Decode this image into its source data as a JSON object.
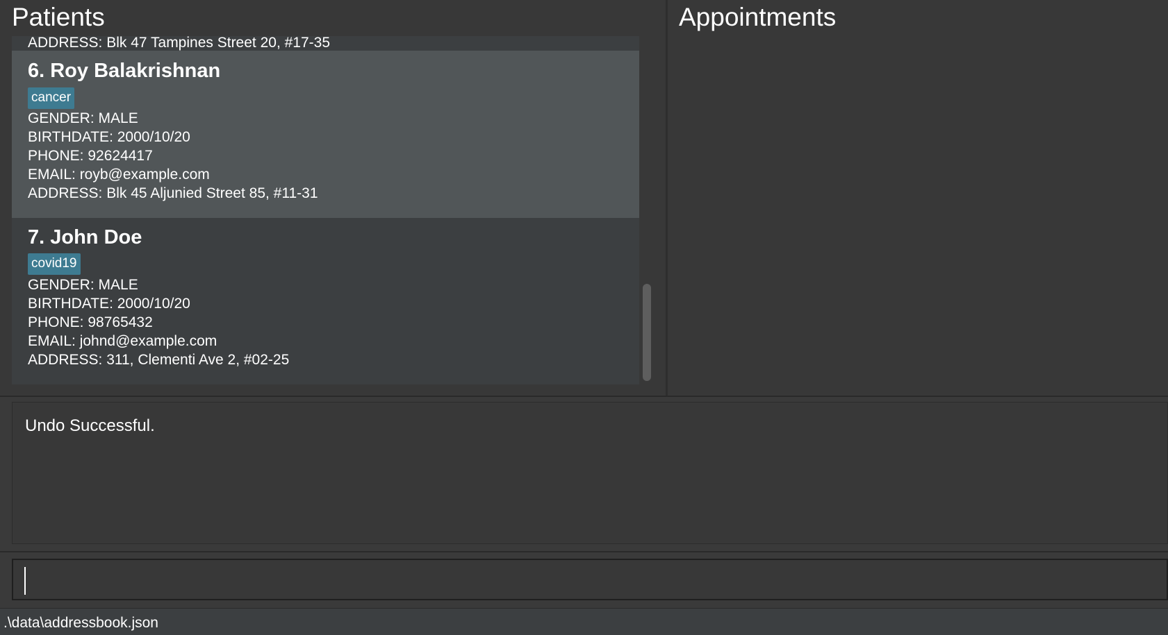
{
  "patients": {
    "title": "Patients",
    "partial_card_text": "ADDRESS: Blk 47 Tampines Street 20, #17-35",
    "cards": [
      {
        "name": "6.  Roy Balakrishnan",
        "tag": "cancer",
        "gender": "GENDER: MALE",
        "birthdate": "BIRTHDATE: 2000/10/20",
        "phone": "PHONE: 92624417",
        "email": "EMAIL: royb@example.com",
        "address": "ADDRESS: Blk 45 Aljunied Street 85, #11-31"
      },
      {
        "name": "7.  John Doe",
        "tag": "covid19",
        "gender": "GENDER: MALE",
        "birthdate": "BIRTHDATE: 2000/10/20",
        "phone": "PHONE: 98765432",
        "email": "EMAIL: johnd@example.com",
        "address": "ADDRESS: 311, Clementi Ave 2, #02-25"
      }
    ]
  },
  "appointments": {
    "title": "Appointments"
  },
  "result": {
    "message": "Undo Successful."
  },
  "command": {
    "value": ""
  },
  "status": {
    "file_path": ".\\data\\addressbook.json"
  },
  "colors": {
    "background": "#383838",
    "card_selected": "#515658",
    "card_normal": "#3c3f41",
    "tag": "#3e7b91"
  }
}
